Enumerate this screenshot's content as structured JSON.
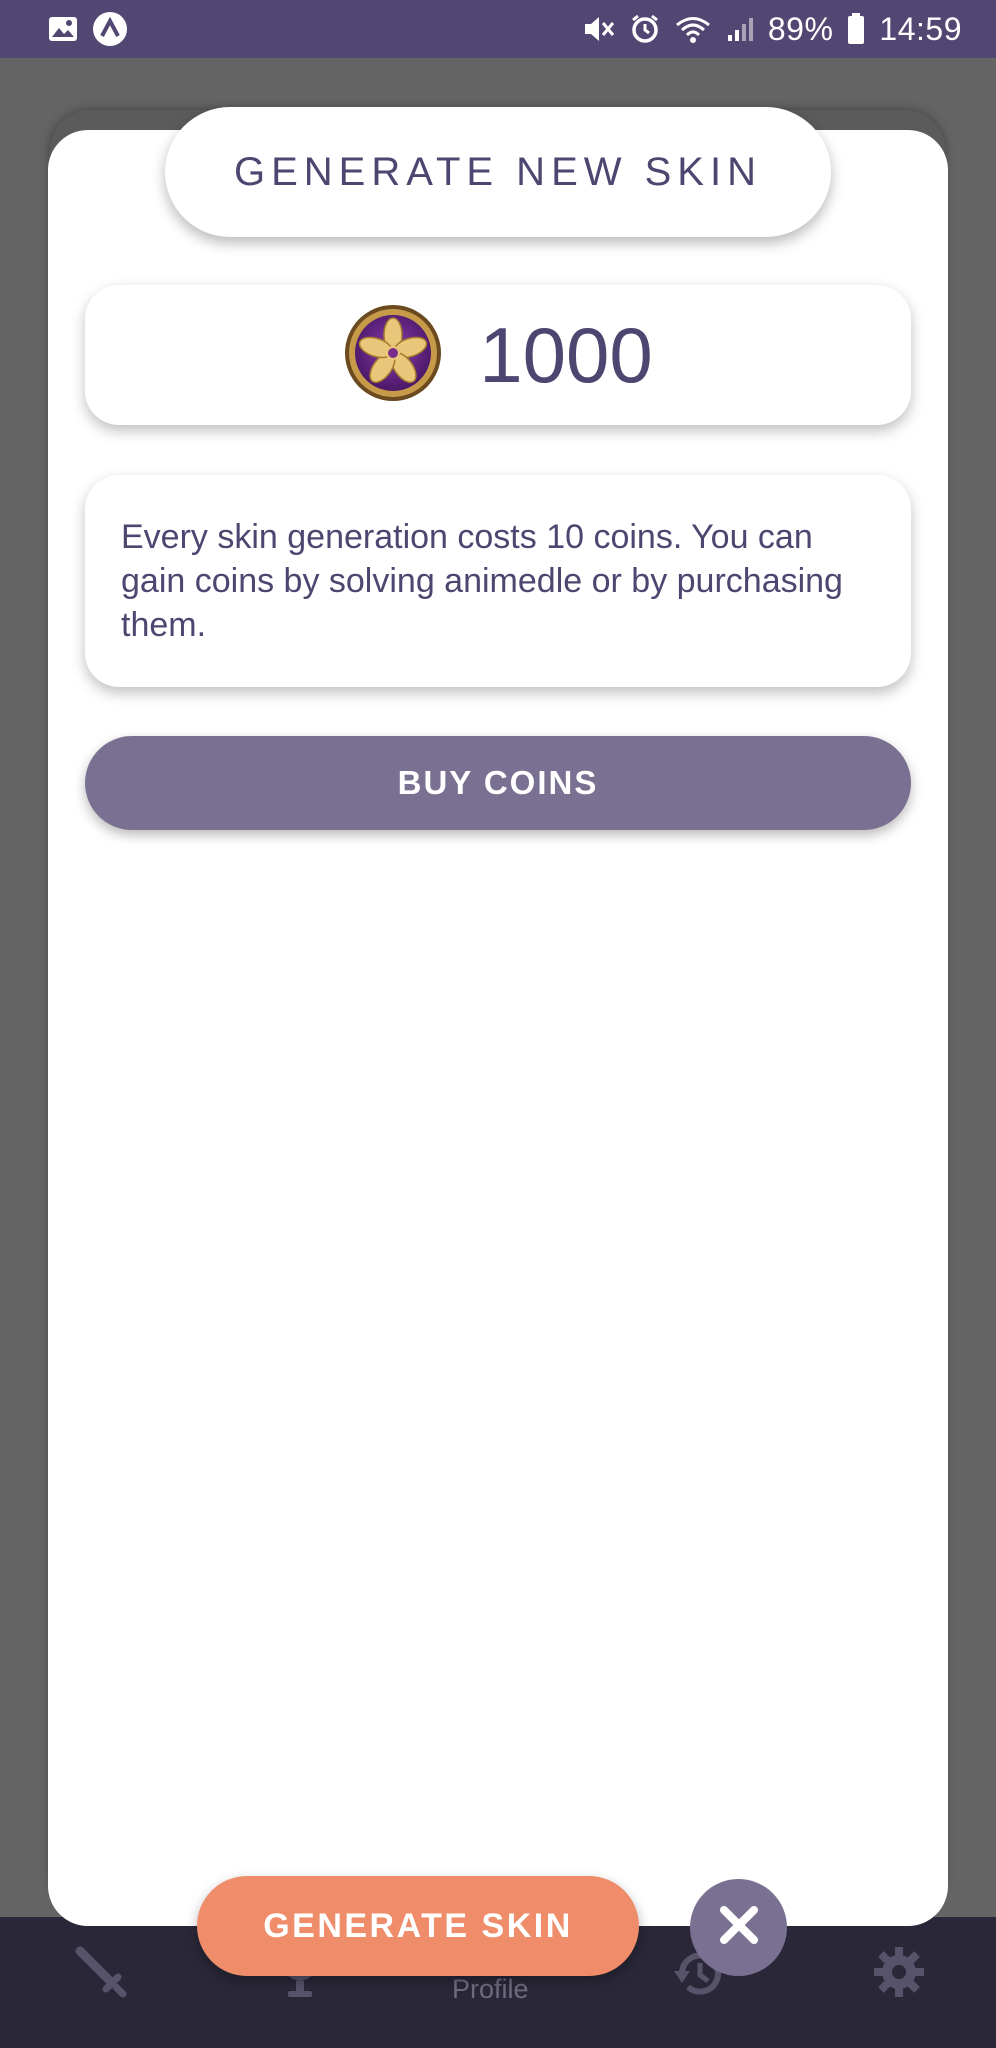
{
  "status_bar": {
    "battery_percent": "89%",
    "time": "14:59",
    "icons": [
      "gallery-icon",
      "app-notification-icon",
      "mute-icon",
      "alarm-icon",
      "wifi-icon",
      "signal-icon",
      "battery-icon"
    ]
  },
  "modal": {
    "title": "GENERATE NEW SKIN",
    "coin_balance": "1000",
    "coin_icon": "flower-coin-icon",
    "info_text": "Every skin generation costs 10 coins. You can gain coins by solving animedle or by purchasing them.",
    "buy_button_label": "BUY COINS",
    "generate_button_label": "GENERATE SKIN",
    "close_icon": "close-icon"
  },
  "bottom_nav": {
    "items": [
      {
        "icon": "sword-icon",
        "label": ""
      },
      {
        "icon": "trophy-icon",
        "label": ""
      },
      {
        "icon": "profile-icon",
        "label": "Profile"
      },
      {
        "icon": "history-icon",
        "label": ""
      },
      {
        "icon": "gear-icon",
        "label": ""
      }
    ]
  },
  "colors": {
    "status_bar": "#524672",
    "accent_purple": "#7a7091",
    "text_purple": "#4d4670",
    "generate_orange": "#ef8d6a",
    "nav_background": "#2a2838",
    "backdrop": "#646464"
  }
}
